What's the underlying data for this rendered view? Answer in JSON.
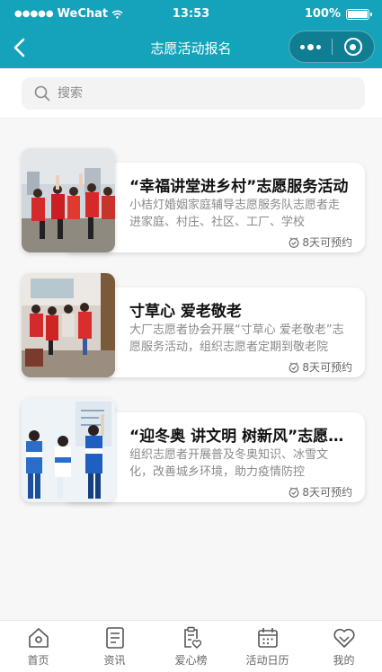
{
  "status_bar": {
    "signal": "●●●●●",
    "carrier": "WeChat",
    "time": "13:53",
    "battery": "100%"
  },
  "navbar": {
    "title": "志愿活动报名",
    "accent_color": "#15a2bb"
  },
  "search": {
    "placeholder": "搜索"
  },
  "activities": [
    {
      "title": "“幸福讲堂进乡村”志愿服务活动",
      "description": "小桔灯婚姻家庭辅导志愿服务队志愿者走进家庭、村庄、社区、工厂、学校",
      "availability": "8天可预约"
    },
    {
      "title": "寸草心 爱老敬老",
      "description": "大厂志愿者协会开展“寸草心 爱老敬老”志愿服务活动，组织志愿者定期到敬老院",
      "availability": "8天可预约"
    },
    {
      "title": "“迎冬奥 讲文明 树新风”志愿服务活动",
      "description": "组织志愿者开展普及冬奥知识、冰雪文化，改善城乡环境，助力疫情防控",
      "availability": "8天可预约"
    }
  ],
  "tabbar": {
    "items": [
      {
        "label": "首页",
        "icon": "home-icon"
      },
      {
        "label": "资讯",
        "icon": "news-icon"
      },
      {
        "label": "爱心榜",
        "icon": "love-board-icon"
      },
      {
        "label": "活动日历",
        "icon": "calendar-icon"
      },
      {
        "label": "我的",
        "icon": "heart-icon"
      }
    ]
  }
}
